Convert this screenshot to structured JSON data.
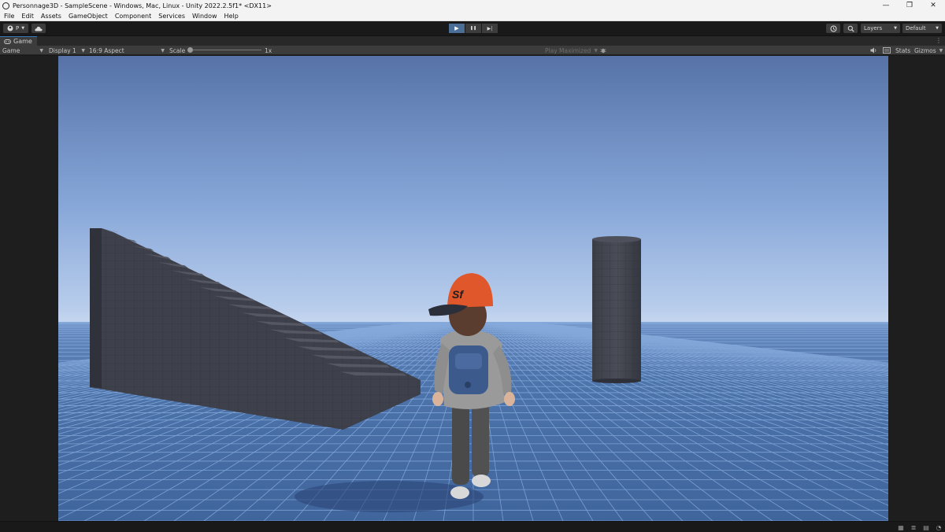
{
  "window": {
    "title": "Personnage3D - SampleScene - Windows, Mac, Linux - Unity 2022.2.5f1* <DX11>",
    "minimize": "—",
    "restore": "❐",
    "close": "✕"
  },
  "menu": [
    "File",
    "Edit",
    "Assets",
    "GameObject",
    "Component",
    "Services",
    "Window",
    "Help"
  ],
  "toolbar": {
    "account_label": "P",
    "account_icon": "account-icon",
    "cloud_icon": "cloud-icon",
    "play_icon": "▶",
    "pause_icon": "❚❚",
    "step_icon": "▶|",
    "history_icon": "history-icon",
    "search_icon": "search-icon",
    "layers_label": "Layers",
    "layout_label": "Default"
  },
  "tab": {
    "label": "Game",
    "kebab": "⋮"
  },
  "gamebar": {
    "mode": "Game",
    "display": "Display 1",
    "aspect": "16:9 Aspect",
    "scale_label": "Scale",
    "scale_value": "1x",
    "scale_fraction": 0,
    "play_maximized": "Play Maximized",
    "stats": "Stats",
    "gizmos": "Gizmos"
  },
  "colors": {
    "accent_play": "#4a6e95",
    "sky_top": "#5672a6",
    "sky_horizon": "#aec6ea",
    "ground": "#4a6fa5",
    "grid_line": "#8fb3e3",
    "cap": "#e0572b"
  },
  "scene": {
    "cap_text": "Sf"
  }
}
